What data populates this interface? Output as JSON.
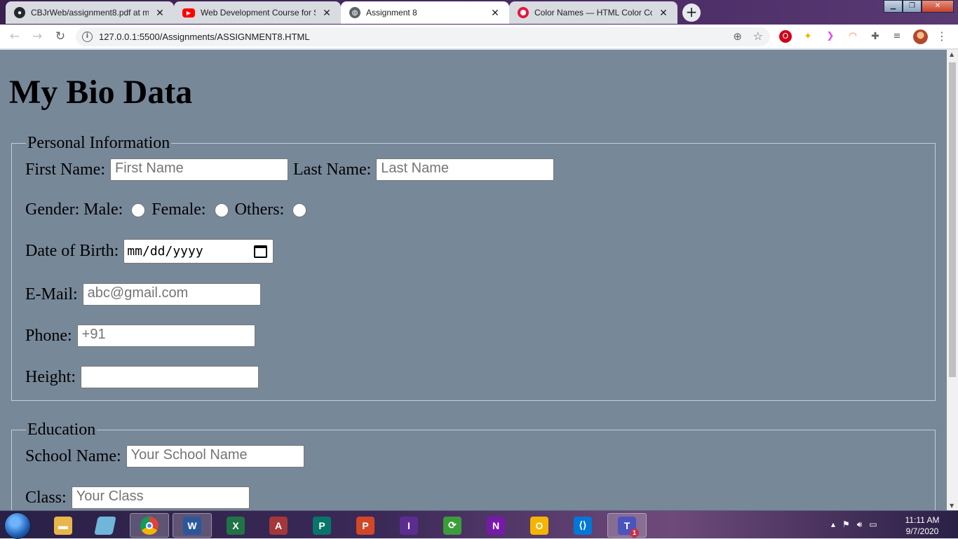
{
  "browser": {
    "tabs": [
      {
        "title": "CBJrWeb/assignment8.pdf at ma",
        "icon": "github-icon"
      },
      {
        "title": "Web Development Course for Sc",
        "icon": "youtube-icon"
      },
      {
        "title": "Assignment 8",
        "icon": "globe-icon"
      },
      {
        "title": "Color Names — HTML Color Cod",
        "icon": "opera-icon"
      }
    ],
    "url": "127.0.0.1:5500/Assignments/ASSIGNMENT8.HTML"
  },
  "page": {
    "title": "My Bio Data",
    "personal": {
      "legend": "Personal Information",
      "first_name_label": "First Name:",
      "first_name_placeholder": "First Name",
      "last_name_label": "Last Name:",
      "last_name_placeholder": "Last Name",
      "gender_label": "Gender:",
      "male_label": "Male:",
      "female_label": "Female:",
      "others_label": "Others:",
      "dob_label": "Date of Birth:",
      "dob_placeholder": "mm/dd/yyyy",
      "email_label": "E-Mail:",
      "email_placeholder": "abc@gmail.com",
      "phone_label": "Phone:",
      "phone_value": "+91",
      "height_label": "Height:",
      "height_value": ""
    },
    "education": {
      "legend": "Education",
      "school_label": "School Name:",
      "school_placeholder": "Your School Name",
      "class_label": "Class:",
      "class_placeholder": "Your Class"
    }
  },
  "taskbar": {
    "time": "11:11 AM",
    "date": "9/7/2020",
    "teams_badge": "1"
  },
  "colors": {
    "page_background": "#778899",
    "tab_active": "#ffffff",
    "tab_inactive": "#d8dbe0"
  }
}
